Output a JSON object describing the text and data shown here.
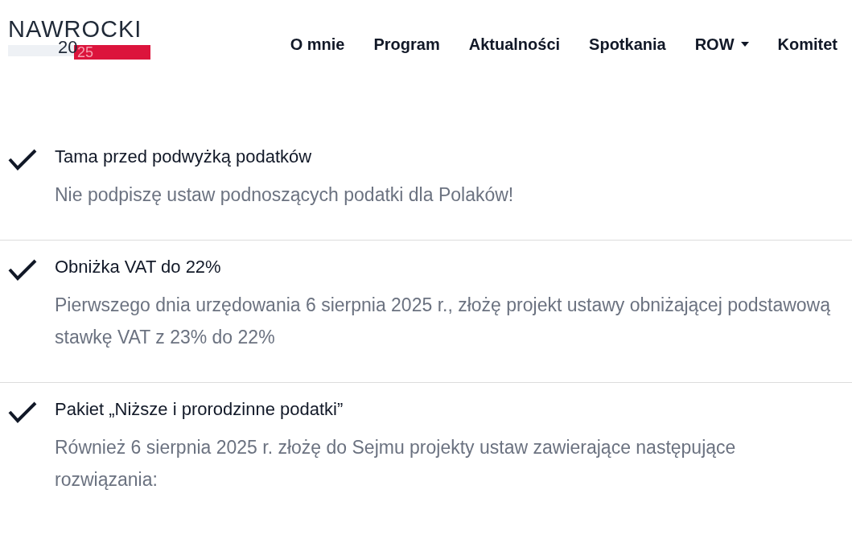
{
  "logo": {
    "name": "NAWROCKI",
    "year_start": "20",
    "year_end": "25"
  },
  "nav": [
    {
      "label": "O mnie",
      "dropdown": false
    },
    {
      "label": "Program",
      "dropdown": false
    },
    {
      "label": "Aktualności",
      "dropdown": false
    },
    {
      "label": "Spotkania",
      "dropdown": false
    },
    {
      "label": "ROW",
      "dropdown": true
    },
    {
      "label": "Komitet",
      "dropdown": false
    }
  ],
  "items": [
    {
      "title": "Tama przed podwyżką podatków",
      "text": "Nie podpiszę ustaw podnoszących podatki dla Polaków!"
    },
    {
      "title": "Obniżka VAT do 22%",
      "text": "Pierwszego dnia urzędowania 6 sierpnia 2025 r., złożę projekt ustawy obniżającej podstawową stawkę VAT z 23% do 22%"
    },
    {
      "title": "Pakiet „Niższe i prorodzinne podatki”",
      "text": "Również 6 sierpnia 2025 r. złożę do Sejmu projekty ustaw zawierające następujące rozwiązania:"
    }
  ]
}
